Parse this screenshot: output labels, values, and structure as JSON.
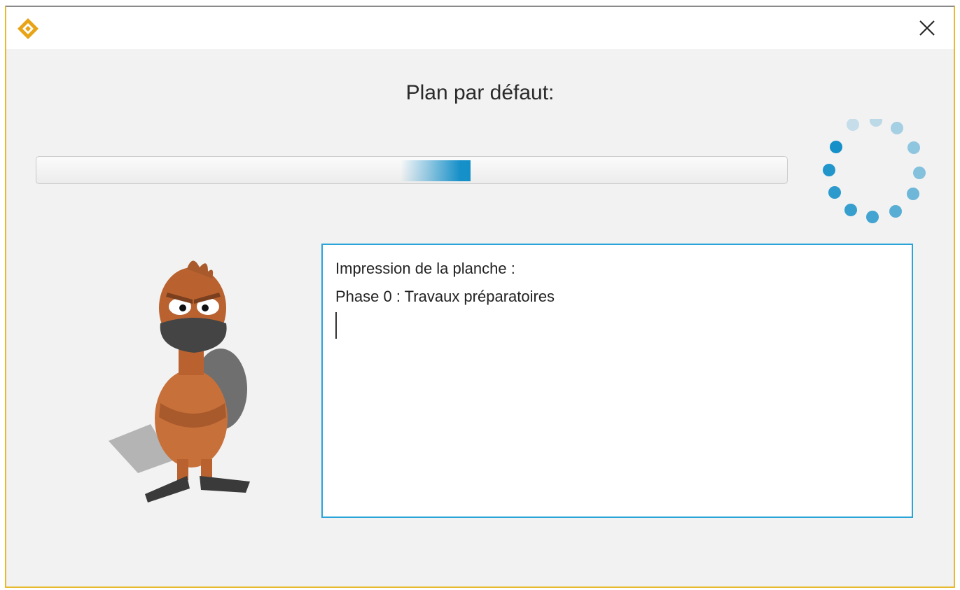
{
  "window": {
    "logo_icon": "diamond-logo-icon",
    "close_icon": "close-x-icon",
    "accent_color": "#e8b92e"
  },
  "main": {
    "title": "Plan par défaut:",
    "progress": {
      "mode": "indeterminate",
      "color": "#1690c8"
    },
    "spinner_icon": "loading-spinner-icon",
    "mascot_icon": "platypus-mascot-icon",
    "log": {
      "lines": [
        "Impression de la planche :",
        "Phase 0 : Travaux préparatoires"
      ]
    }
  }
}
